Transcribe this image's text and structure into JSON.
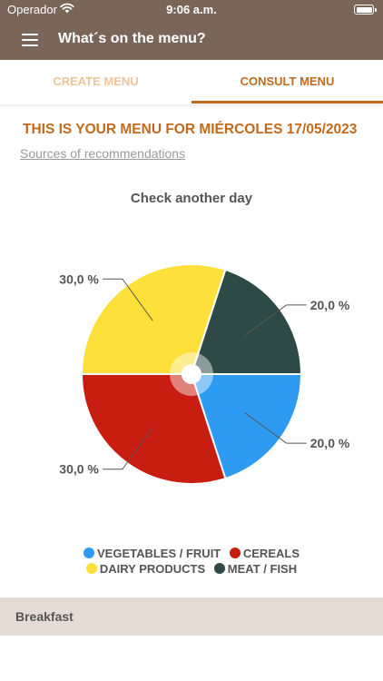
{
  "status_bar": {
    "carrier": "Operador",
    "time": "9:06 a.m."
  },
  "app_bar": {
    "title": "What´s on the menu?"
  },
  "tabs": [
    {
      "label": "CREATE MENU",
      "active": false
    },
    {
      "label": "CONSULT MENU",
      "active": true
    }
  ],
  "main": {
    "heading": "THIS IS YOUR MENU FOR MIÉRCOLES 17/05/2023",
    "sources_link": "Sources of recommendations",
    "check_day": "Check another day"
  },
  "chart_data": {
    "type": "pie",
    "slices": [
      {
        "name": "VEGETABLES / FRUIT",
        "value": 20.0,
        "label": "20,0 %",
        "color": "#2e9bf3"
      },
      {
        "name": "CEREALS",
        "value": 30.0,
        "label": "30,0 %",
        "color": "#c81e12"
      },
      {
        "name": "DAIRY PRODUCTS",
        "value": 30.0,
        "label": "30,0 %",
        "color": "#fde03a"
      },
      {
        "name": "MEAT / FISH",
        "value": 20.0,
        "label": "20,0 %",
        "color": "#2e4a47"
      }
    ],
    "legend_position": "bottom"
  },
  "meals": {
    "breakfast_label": "Breakfast"
  }
}
